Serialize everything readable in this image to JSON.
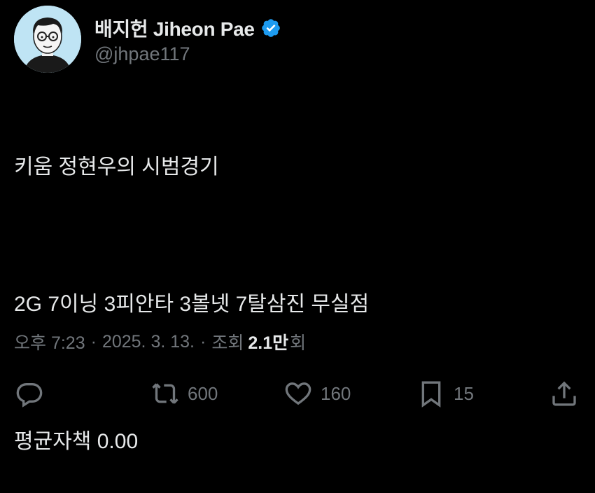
{
  "author": {
    "display_name": "배지헌 Jiheon Pae",
    "handle": "@jhpae117",
    "verified": true,
    "verified_color": "#1d9bf0"
  },
  "tweet": {
    "lines": [
      "키움 정현우의 시범경기",
      "2G 7이닝 3피안타 3볼넷 7탈삼진 무실점",
      "평균자책 0.00"
    ]
  },
  "meta": {
    "time": "오후 7:23",
    "separator": "·",
    "date": "2025. 3. 13.",
    "views_label": "조회",
    "views_count": "2.1만",
    "views_suffix": "회"
  },
  "actions": {
    "reply": {
      "icon": "reply-icon",
      "count": ""
    },
    "retweet": {
      "icon": "retweet-icon",
      "count": "600"
    },
    "like": {
      "icon": "heart-icon",
      "count": "160"
    },
    "bookmark": {
      "icon": "bookmark-icon",
      "count": "15"
    },
    "share": {
      "icon": "share-icon",
      "count": ""
    }
  },
  "colors": {
    "background": "#000000",
    "text": "#e7e9ea",
    "secondary": "#71767b",
    "avatar_bg": "#bfe4f4"
  }
}
